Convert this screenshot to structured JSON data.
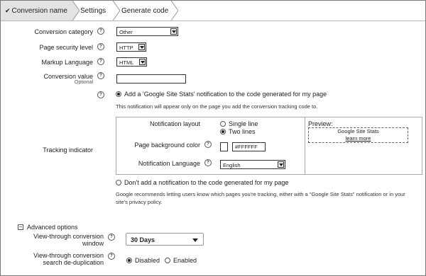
{
  "tabs": [
    {
      "label": "Conversion name",
      "check": "✔"
    },
    {
      "label": "Settings"
    },
    {
      "label": "Generate code"
    }
  ],
  "form": {
    "category": {
      "label": "Conversion category",
      "value": "Other"
    },
    "security": {
      "label": "Page security level",
      "value": "HTTP"
    },
    "markup": {
      "label": "Markup Language",
      "value": "HTML"
    },
    "value": {
      "label": "Conversion value",
      "sublabel": "Optional",
      "value": ""
    },
    "help_glyph": "?"
  },
  "tracking": {
    "label": "Tracking indicator",
    "add_option": "Add a 'Google Site Stats' notification to the code generated for my page",
    "add_note": "This notification will appear only on the page you add the conversion tracking code to.",
    "layout_label": "Notification layout",
    "layout_options": [
      "Single line",
      "Two lines"
    ],
    "layout_selected": "Two lines",
    "bg_label": "Page background color",
    "bg_value": "#FFFFFF",
    "lang_label": "Notification Language",
    "lang_value": "English",
    "preview_label": "Preview:",
    "preview_line1": "Google Site Stats",
    "preview_line2": "learn more",
    "dont_option": "Don't add a notification to the code generated for my page",
    "recommend_line1": "Google recommends letting users know which pages you're tracking, either with a \"Google Site Stats\" notification or in your",
    "recommend_line2": "site's privacy policy.",
    "selected": "add"
  },
  "advanced": {
    "toggle_glyph": "−",
    "label": "Advanced options",
    "window_label1": "View-through conversion",
    "window_label2": "window",
    "window_value": "30 Days",
    "dedup_label1": "View-through conversion",
    "dedup_label2": "search de-duplication",
    "dedup_options": [
      "Disabled",
      "Enabled"
    ],
    "dedup_selected": "Disabled"
  }
}
